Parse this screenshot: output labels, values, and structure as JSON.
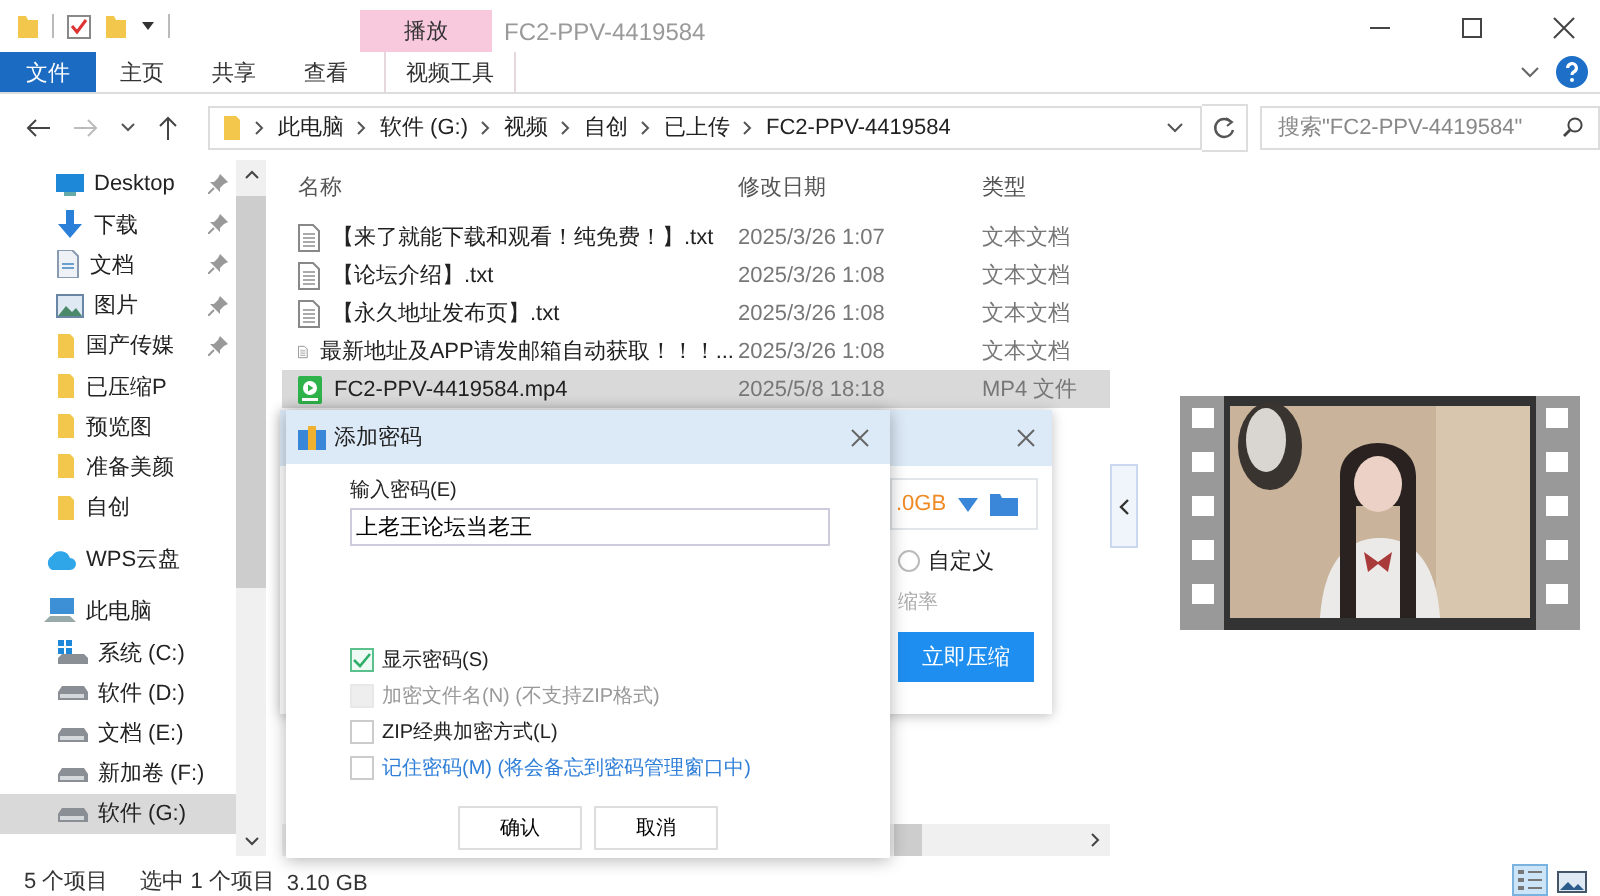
{
  "window": {
    "title": "FC2-PPV-4419584"
  },
  "contextual_tab": {
    "label": "播放"
  },
  "ribbon_tabs": [
    {
      "label": "文件",
      "kind": "file"
    },
    {
      "label": "主页",
      "kind": "plain"
    },
    {
      "label": "共享",
      "kind": "plain"
    },
    {
      "label": "查看",
      "kind": "plain"
    },
    {
      "label": "视频工具",
      "kind": "contextual"
    }
  ],
  "address": {
    "breadcrumb": [
      "此电脑",
      "软件 (G:)",
      "视频",
      "自创",
      "已上传",
      "FC2-PPV-4419584"
    ]
  },
  "search": {
    "placeholder": "搜索\"FC2-PPV-4419584\""
  },
  "sidebar": {
    "items": [
      {
        "label": "Desktop",
        "kind": "desktop",
        "pinned": true,
        "selected": false
      },
      {
        "label": "下载",
        "kind": "download",
        "pinned": true,
        "selected": false
      },
      {
        "label": "文档",
        "kind": "document",
        "pinned": true,
        "selected": false
      },
      {
        "label": "图片",
        "kind": "pictures",
        "pinned": true,
        "selected": false
      },
      {
        "label": "国产传媒",
        "kind": "folder",
        "pinned": true,
        "selected": false
      },
      {
        "label": "已压缩P",
        "kind": "folder",
        "pinned": false,
        "selected": false
      },
      {
        "label": "预览图",
        "kind": "folder",
        "pinned": false,
        "selected": false
      },
      {
        "label": "准备美颜",
        "kind": "folder",
        "pinned": false,
        "selected": false
      },
      {
        "label": "自创",
        "kind": "folder",
        "pinned": false,
        "selected": false
      },
      {
        "label": "WPS云盘",
        "kind": "cloud",
        "pinned": false,
        "selected": false
      },
      {
        "label": "此电脑",
        "kind": "computer",
        "pinned": false,
        "selected": false
      },
      {
        "label": "系统 (C:)",
        "kind": "system-drive",
        "pinned": false,
        "selected": false
      },
      {
        "label": "软件 (D:)",
        "kind": "drive",
        "pinned": false,
        "selected": false
      },
      {
        "label": "文档 (E:)",
        "kind": "drive",
        "pinned": false,
        "selected": false
      },
      {
        "label": "新加卷 (F:)",
        "kind": "drive",
        "pinned": false,
        "selected": false
      },
      {
        "label": "软件 (G:)",
        "kind": "drive",
        "pinned": false,
        "selected": true
      }
    ]
  },
  "table": {
    "columns": [
      "名称",
      "修改日期",
      "类型"
    ],
    "rows": [
      {
        "name": "【来了就能下载和观看！纯免费！】.txt",
        "date": "2025/3/26 1:07",
        "type": "文本文档",
        "kind": "text",
        "selected": false
      },
      {
        "name": "【论坛介绍】.txt",
        "date": "2025/3/26 1:08",
        "type": "文本文档",
        "kind": "text",
        "selected": false
      },
      {
        "name": "【永久地址发布页】.txt",
        "date": "2025/3/26 1:08",
        "type": "文本文档",
        "kind": "text",
        "selected": false
      },
      {
        "name": "最新地址及APP请发邮箱自动获取！！！...",
        "date": "2025/3/26 1:08",
        "type": "文本文档",
        "kind": "text",
        "selected": false
      },
      {
        "name": "FC2-PPV-4419584.mp4",
        "date": "2025/5/8 18:18",
        "type": "MP4 文件",
        "kind": "video",
        "selected": true
      }
    ]
  },
  "status_bar": {
    "count": "5 个项目",
    "selection": "选中 1 个项目",
    "size": "3.10 GB"
  },
  "compress_dialog": {
    "size": ".0GB",
    "option": {
      "label": "自定义",
      "selected": false
    },
    "rate_label": "缩率",
    "button": "立即压缩"
  },
  "password_dialog": {
    "title": "添加密码",
    "field_label": "输入密码(E)",
    "value": "上老王论坛当老王",
    "options": [
      {
        "label": "显示密码(S)",
        "checked": true,
        "disabled": false,
        "kind": "plain"
      },
      {
        "label": "加密文件名(N) (不支持ZIP格式)",
        "checked": false,
        "disabled": true,
        "kind": "plain"
      },
      {
        "label": "ZIP经典加密方式(L)",
        "checked": false,
        "disabled": false,
        "kind": "plain"
      },
      {
        "label": "记住密码(M) (将会备忘到密码管理窗口中)",
        "checked": false,
        "disabled": false,
        "kind": "link"
      }
    ],
    "buttons": [
      "确认",
      "取消"
    ]
  }
}
